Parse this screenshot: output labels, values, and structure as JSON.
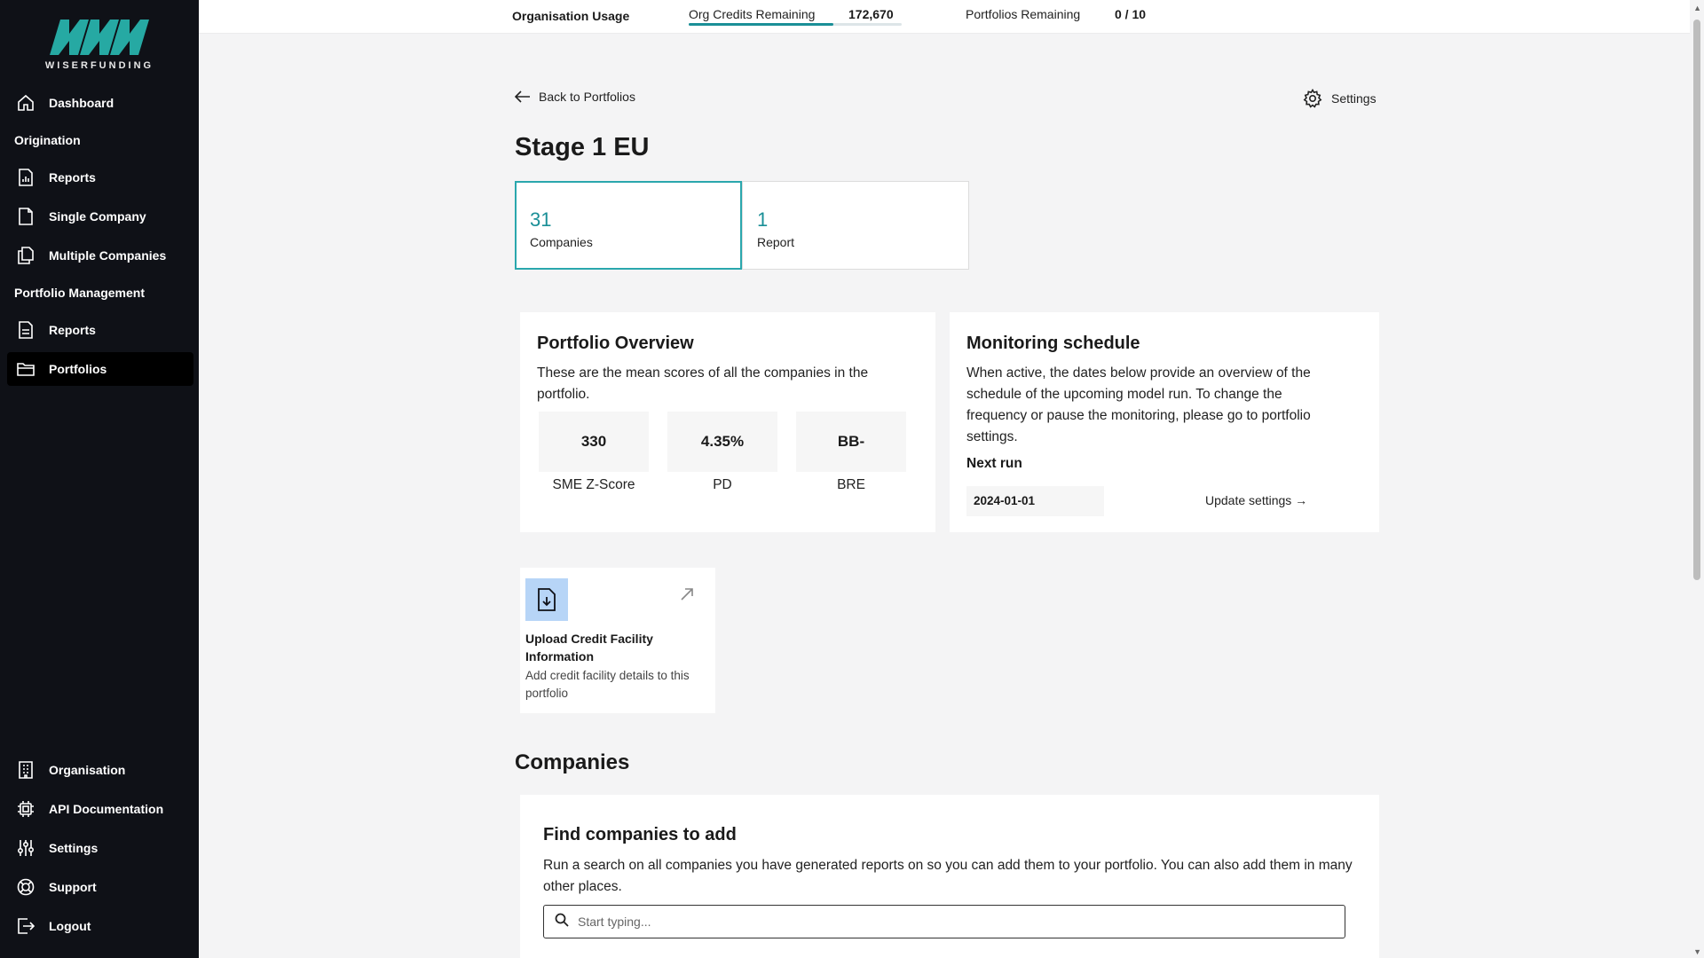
{
  "sidebar": {
    "logo_text": "WISERFUNDING",
    "dashboard": "Dashboard",
    "origination_heading": "Origination",
    "orig_reports": "Reports",
    "single_company": "Single Company",
    "multiple_companies": "Multiple Companies",
    "portfolio_heading": "Portfolio Management",
    "pm_reports": "Reports",
    "portfolios": "Portfolios",
    "organisation": "Organisation",
    "api_docs": "API Documentation",
    "settings": "Settings",
    "support": "Support",
    "logout": "Logout"
  },
  "topbar": {
    "title": "Organisation Usage",
    "credits_label": "Org Credits Remaining",
    "credits_value": "172,670",
    "credits_fill_fraction": 0.68,
    "portfolios_label": "Portfolios Remaining",
    "portfolios_value": "0 / 10"
  },
  "header": {
    "back_label": "Back to Portfolios",
    "settings_label": "Settings",
    "title": "Stage 1 EU"
  },
  "stats": {
    "companies_count": "31",
    "companies_label": "Companies",
    "reports_count": "1",
    "reports_label": "Report"
  },
  "overview": {
    "title": "Portfolio Overview",
    "desc": "These are the mean scores of all the companies in the portfolio.",
    "metrics": [
      {
        "value": "330",
        "label": "SME Z-Score"
      },
      {
        "value": "4.35%",
        "label": "PD"
      },
      {
        "value": "BB-",
        "label": "BRE"
      }
    ]
  },
  "monitoring": {
    "title": "Monitoring schedule",
    "desc": "When active, the dates below provide an overview of the schedule of the upcoming model run. To change the frequency or pause the monitoring, please go to portfolio settings.",
    "next_run_label": "Next run",
    "next_run_date": "2024-01-01",
    "update_link": "Update settings →"
  },
  "upload": {
    "title": "Upload Credit Facility Information",
    "desc": "Add credit facility details to this portfolio"
  },
  "companies": {
    "section_title": "Companies",
    "find_title": "Find companies to add",
    "find_desc": "Run a search on all companies you have generated reports on so you can add them to your portfolio. You can also add them in many other places.",
    "search_placeholder": "Start typing..."
  }
}
